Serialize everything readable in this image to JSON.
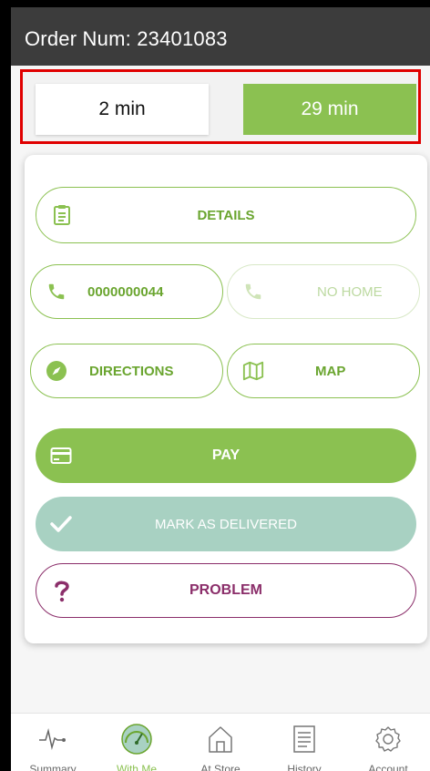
{
  "header": {
    "title": "Order Num: 23401083"
  },
  "timers": {
    "left": "2 min",
    "right": "29 min"
  },
  "actions": {
    "details": "DETAILS",
    "phone": "0000000044",
    "no_home": "NO HOME",
    "directions": "DIRECTIONS",
    "map": "MAP",
    "pay": "PAY",
    "mark_delivered": "MARK AS DELIVERED",
    "problem": "PROBLEM"
  },
  "tabs": [
    {
      "label": "Summary",
      "icon": "pulse-icon",
      "active": false
    },
    {
      "label": "With Me",
      "icon": "speedometer-icon",
      "active": true
    },
    {
      "label": "At Store",
      "icon": "store-icon",
      "active": false
    },
    {
      "label": "History",
      "icon": "document-list-icon",
      "active": false
    },
    {
      "label": "Account",
      "icon": "gear-icon",
      "active": false
    }
  ],
  "colors": {
    "accent_green": "#8bc151",
    "teal": "#a8d1c2",
    "purple": "#8b2e6a",
    "header_bg": "#3c3c3c",
    "highlight_border": "#e00000"
  }
}
